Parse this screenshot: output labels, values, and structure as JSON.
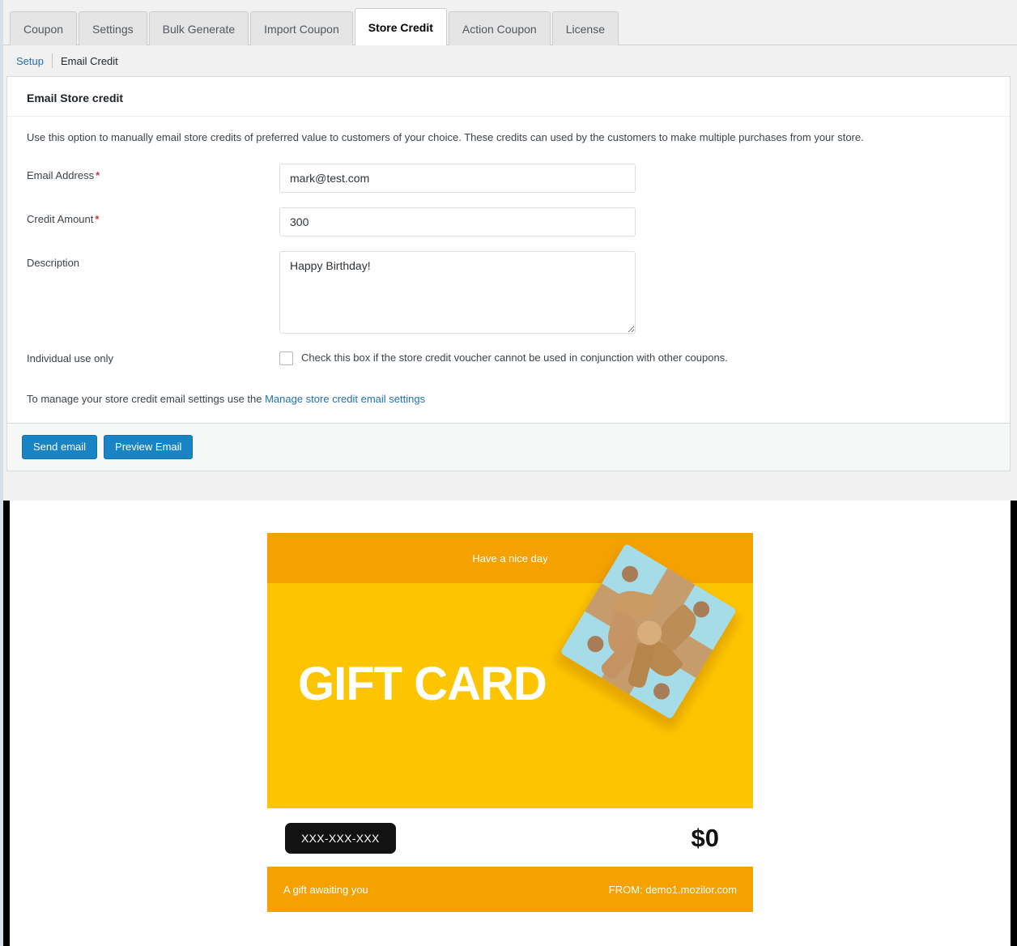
{
  "tabs": [
    {
      "label": "Coupon",
      "active": false
    },
    {
      "label": "Settings",
      "active": false
    },
    {
      "label": "Bulk Generate",
      "active": false
    },
    {
      "label": "Import Coupon",
      "active": false
    },
    {
      "label": "Store Credit",
      "active": true
    },
    {
      "label": "Action Coupon",
      "active": false
    },
    {
      "label": "License",
      "active": false
    }
  ],
  "subnav": {
    "setup_label": "Setup",
    "current_label": "Email Credit"
  },
  "panel": {
    "title": "Email Store credit",
    "intro": "Use this option to manually email store credits of preferred value to customers of your choice. These credits can used by the customers to make multiple purchases from your store.",
    "fields": {
      "email": {
        "label": "Email Address",
        "required_marker": "*",
        "value": "mark@test.com",
        "placeholder": ""
      },
      "amount": {
        "label": "Credit Amount",
        "required_marker": "*",
        "value": "300",
        "placeholder": ""
      },
      "description": {
        "label": "Description",
        "value": "Happy Birthday!",
        "placeholder": ""
      },
      "individual_use": {
        "label": "Individual use only",
        "checkbox_text": "Check this box if the store credit voucher cannot be used in conjunction with other coupons.",
        "checked": false
      }
    },
    "manage": {
      "prefix": "To manage your store credit email settings use the ",
      "link_label": "Manage store credit email settings"
    }
  },
  "actions": {
    "send_label": "Send email",
    "preview_label": "Preview Email"
  },
  "preview": {
    "banner_tagline": "Have a nice day",
    "card_title": "GIFT CARD",
    "code": "XXX-XXX-XXX",
    "amount": "$0",
    "footer_left": "A gift awaiting you",
    "footer_right": "FROM: demo1.mozilor.com"
  },
  "colors": {
    "accent_blue": "#1a83c4",
    "link_blue": "#2271b1",
    "required_red": "#d63638",
    "card_yellow": "#FDC500",
    "card_orange": "#F5A200",
    "code_black": "#121212",
    "giftbox_blue": "#A6DCE8",
    "ribbon_tan": "#C69C6D",
    "dot_brown": "#A77C56"
  }
}
